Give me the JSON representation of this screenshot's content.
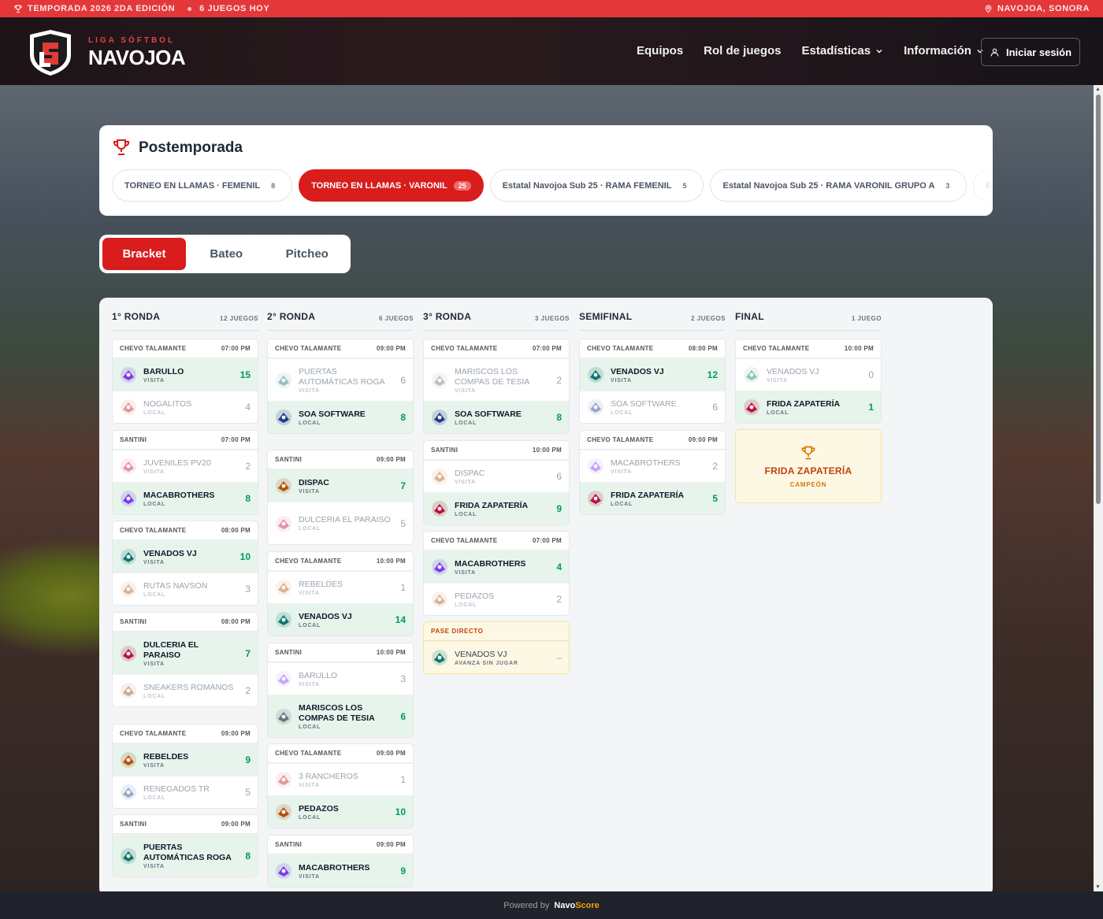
{
  "topbar": {
    "season": "TEMPORADA 2026 2DA EDICIÓN",
    "games_today": "6 JUEGOS HOY",
    "location": "NAVOJOA, SONORA"
  },
  "header": {
    "brand_small": "LIGA SÓFTBOL",
    "brand": "NAVOJOA",
    "nav": [
      "Equipos",
      "Rol de juegos",
      "Estadísticas",
      "Información"
    ],
    "login": "Iniciar sesión"
  },
  "postseason": {
    "title": "Postemporada",
    "tabs": [
      {
        "label": "TORNEO EN LLAMAS · FEMENIL",
        "count": "8"
      },
      {
        "label": "TORNEO EN LLAMAS · VARONIL",
        "count": "25"
      },
      {
        "label": "Estatal Navojoa Sub 25 · RAMA FEMENIL",
        "count": "5"
      },
      {
        "label": "Estatal Navojoa Sub 25 · RAMA VARONIL GRUPO A",
        "count": "3"
      },
      {
        "label": "Estatal N",
        "count": ""
      }
    ]
  },
  "segment": {
    "bracket": "Bracket",
    "bateo": "Bateo",
    "pitcheo": "Pitcheo"
  },
  "colors": {
    "accent": "#d91c1c",
    "win_bg": "#e6f4ec",
    "score": "#059669"
  },
  "rounds": [
    {
      "title": "1° RONDA",
      "count": "12 JUEGOS",
      "games": [
        {
          "field": "CHEVO TALAMANTE",
          "time": "07:00 PM",
          "teams": [
            {
              "name": "BARULLO",
              "role": "VISITA",
              "score": "15",
              "win": true
            },
            {
              "name": "NOGALITOS",
              "role": "LOCAL",
              "score": "4",
              "win": false
            }
          ]
        },
        {
          "field": "SANTINI",
          "time": "07:00 PM",
          "teams": [
            {
              "name": "JUVENILES PV20",
              "role": "VISITA",
              "score": "2",
              "win": false
            },
            {
              "name": "MACABROTHERS",
              "role": "LOCAL",
              "score": "8",
              "win": true
            }
          ]
        },
        {
          "field": "CHEVO TALAMANTE",
          "time": "08:00 PM",
          "teams": [
            {
              "name": "VENADOS VJ",
              "role": "VISITA",
              "score": "10",
              "win": true
            },
            {
              "name": "RUTAS NAVSON",
              "role": "LOCAL",
              "score": "3",
              "win": false
            }
          ]
        },
        {
          "field": "SANTINI",
          "time": "08:00 PM",
          "teams": [
            {
              "name": "DULCERIA EL PARAISO",
              "role": "VISITA",
              "score": "7",
              "win": true
            },
            {
              "name": "SNEAKERS ROMANOS",
              "role": "LOCAL",
              "score": "2",
              "win": false
            }
          ]
        },
        {
          "field": "CHEVO TALAMANTE",
          "time": "09:00 PM",
          "teams": [
            {
              "name": "REBELDES",
              "role": "VISITA",
              "score": "9",
              "win": true
            },
            {
              "name": "RENEGADOS TR",
              "role": "LOCAL",
              "score": "5",
              "win": false
            }
          ]
        },
        {
          "field": "SANTINI",
          "time": "09:00 PM",
          "teams": [
            {
              "name": "PUERTAS AUTOMÁTICAS ROGA",
              "role": "VISITA",
              "score": "8",
              "win": true
            }
          ]
        }
      ]
    },
    {
      "title": "2° RONDA",
      "count": "6 JUEGOS",
      "games": [
        {
          "field": "CHEVO TALAMANTE",
          "time": "09:00 PM",
          "teams": [
            {
              "name": "PUERTAS AUTOMÁTICAS ROGA",
              "role": "VISITA",
              "score": "6",
              "win": false
            },
            {
              "name": "SOA SOFTWARE",
              "role": "LOCAL",
              "score": "8",
              "win": true
            }
          ]
        },
        {
          "field": "SANTINI",
          "time": "09:00 PM",
          "teams": [
            {
              "name": "DISPAC",
              "role": "VISITA",
              "score": "7",
              "win": true
            },
            {
              "name": "DULCERIA EL PARAISO",
              "role": "LOCAL",
              "score": "5",
              "win": false
            }
          ]
        },
        {
          "field": "CHEVO TALAMANTE",
          "time": "10:00 PM",
          "teams": [
            {
              "name": "REBELDES",
              "role": "VISITA",
              "score": "1",
              "win": false
            },
            {
              "name": "VENADOS VJ",
              "role": "LOCAL",
              "score": "14",
              "win": true
            }
          ]
        },
        {
          "field": "SANTINI",
          "time": "10:00 PM",
          "teams": [
            {
              "name": "BARULLO",
              "role": "VISITA",
              "score": "3",
              "win": false
            },
            {
              "name": "MARISCOS LOS COMPAS DE TESIA",
              "role": "LOCAL",
              "score": "6",
              "win": true
            }
          ]
        },
        {
          "field": "CHEVO TALAMANTE",
          "time": "09:00 PM",
          "teams": [
            {
              "name": "3 RANCHEROS",
              "role": "VISITA",
              "score": "1",
              "win": false
            },
            {
              "name": "PEDAZOS",
              "role": "LOCAL",
              "score": "10",
              "win": true
            }
          ]
        },
        {
          "field": "SANTINI",
          "time": "09:00 PM",
          "teams": [
            {
              "name": "MACABROTHERS",
              "role": "VISITA",
              "score": "9",
              "win": true
            }
          ]
        }
      ]
    },
    {
      "title": "3° RONDA",
      "count": "3 JUEGOS",
      "games": [
        {
          "field": "CHEVO TALAMANTE",
          "time": "07:00 PM",
          "teams": [
            {
              "name": "MARISCOS LOS COMPAS DE TESIA",
              "role": "VISITA",
              "score": "2",
              "win": false
            },
            {
              "name": "SOA SOFTWARE",
              "role": "LOCAL",
              "score": "8",
              "win": true
            }
          ]
        },
        {
          "field": "SANTINI",
          "time": "10:00 PM",
          "teams": [
            {
              "name": "DISPAC",
              "role": "VISITA",
              "score": "6",
              "win": false
            },
            {
              "name": "FRIDA ZAPATERÍA",
              "role": "LOCAL",
              "score": "9",
              "win": true
            }
          ]
        },
        {
          "field": "CHEVO TALAMANTE",
          "time": "07:00 PM",
          "teams": [
            {
              "name": "MACABROTHERS",
              "role": "VISITA",
              "score": "4",
              "win": true
            },
            {
              "name": "PEDAZOS",
              "role": "LOCAL",
              "score": "2",
              "win": false
            }
          ]
        }
      ],
      "direct": {
        "label": "PASE DIRECTO",
        "team": "VENADOS VJ",
        "note": "AVANZA SIN JUGAR",
        "score": "–"
      }
    },
    {
      "title": "SEMIFINAL",
      "count": "2 JUEGOS",
      "games": [
        {
          "field": "CHEVO TALAMANTE",
          "time": "08:00 PM",
          "teams": [
            {
              "name": "VENADOS VJ",
              "role": "VISITA",
              "score": "12",
              "win": true
            },
            {
              "name": "SOA SOFTWARE",
              "role": "LOCAL",
              "score": "6",
              "win": false
            }
          ]
        },
        {
          "field": "CHEVO TALAMANTE",
          "time": "09:00 PM",
          "teams": [
            {
              "name": "MACABROTHERS",
              "role": "VISITA",
              "score": "2",
              "win": false
            },
            {
              "name": "FRIDA ZAPATERÍA",
              "role": "LOCAL",
              "score": "5",
              "win": true
            }
          ]
        }
      ]
    },
    {
      "title": "FINAL",
      "count": "1 JUEGO",
      "games": [
        {
          "field": "CHEVO TALAMANTE",
          "time": "10:00 PM",
          "teams": [
            {
              "name": "VENADOS VJ",
              "role": "VISITA",
              "score": "0",
              "win": false
            },
            {
              "name": "FRIDA ZAPATERÍA",
              "role": "LOCAL",
              "score": "1",
              "win": true
            }
          ]
        }
      ],
      "champion": {
        "name": "FRIDA ZAPATERÍA",
        "label": "CAMPEÓN"
      }
    }
  ],
  "footer": {
    "powered": "Powered by",
    "brand_a": "Navo",
    "brand_b": "Score"
  }
}
